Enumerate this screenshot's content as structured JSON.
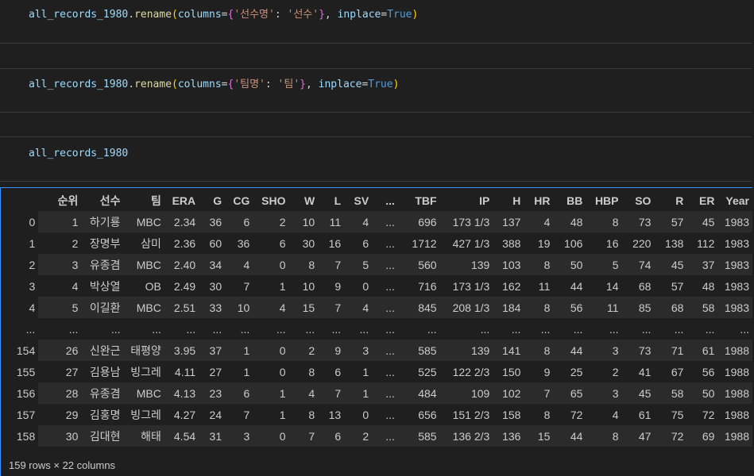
{
  "cells": [
    {
      "tokens": [
        {
          "t": "all_records_1980",
          "c": "var"
        },
        {
          "t": ".",
          "c": "pun"
        },
        {
          "t": "rename",
          "c": "fn"
        },
        {
          "t": "(",
          "c": "par"
        },
        {
          "t": "columns",
          "c": "var"
        },
        {
          "t": "=",
          "c": "op"
        },
        {
          "t": "{",
          "c": "br"
        },
        {
          "t": "'선수명'",
          "c": "str"
        },
        {
          "t": ": ",
          "c": "pun"
        },
        {
          "t": "'선수'",
          "c": "str"
        },
        {
          "t": "}",
          "c": "br"
        },
        {
          "t": ", ",
          "c": "pun"
        },
        {
          "t": "inplace",
          "c": "var"
        },
        {
          "t": "=",
          "c": "op"
        },
        {
          "t": "True",
          "c": "kw"
        },
        {
          "t": ")",
          "c": "par"
        }
      ]
    },
    {
      "tokens": [
        {
          "t": "all_records_1980",
          "c": "var"
        },
        {
          "t": ".",
          "c": "pun"
        },
        {
          "t": "rename",
          "c": "fn"
        },
        {
          "t": "(",
          "c": "par"
        },
        {
          "t": "columns",
          "c": "var"
        },
        {
          "t": "=",
          "c": "op"
        },
        {
          "t": "{",
          "c": "br"
        },
        {
          "t": "'팀명'",
          "c": "str"
        },
        {
          "t": ": ",
          "c": "pun"
        },
        {
          "t": "'팀'",
          "c": "str"
        },
        {
          "t": "}",
          "c": "br"
        },
        {
          "t": ", ",
          "c": "pun"
        },
        {
          "t": "inplace",
          "c": "var"
        },
        {
          "t": "=",
          "c": "op"
        },
        {
          "t": "True",
          "c": "kw"
        },
        {
          "t": ")",
          "c": "par"
        }
      ]
    },
    {
      "tokens": [
        {
          "t": "all_records_1980",
          "c": "var"
        }
      ]
    }
  ],
  "table": {
    "columns": [
      "",
      "순위",
      "선수",
      "팀",
      "ERA",
      "G",
      "CG",
      "SHO",
      "W",
      "L",
      "SV",
      "...",
      "TBF",
      "IP",
      "H",
      "HR",
      "BB",
      "HBP",
      "SO",
      "R",
      "ER",
      "Year"
    ],
    "rows": [
      [
        "0",
        "1",
        "하기룡",
        "MBC",
        "2.34",
        "36",
        "6",
        "2",
        "10",
        "11",
        "4",
        "...",
        "696",
        "173 1/3",
        "137",
        "4",
        "48",
        "8",
        "73",
        "57",
        "45",
        "1983"
      ],
      [
        "1",
        "2",
        "장명부",
        "삼미",
        "2.36",
        "60",
        "36",
        "6",
        "30",
        "16",
        "6",
        "...",
        "1712",
        "427 1/3",
        "388",
        "19",
        "106",
        "16",
        "220",
        "138",
        "112",
        "1983"
      ],
      [
        "2",
        "3",
        "유종겸",
        "MBC",
        "2.40",
        "34",
        "4",
        "0",
        "8",
        "7",
        "5",
        "...",
        "560",
        "139",
        "103",
        "8",
        "50",
        "5",
        "74",
        "45",
        "37",
        "1983"
      ],
      [
        "3",
        "4",
        "박상열",
        "OB",
        "2.49",
        "30",
        "7",
        "1",
        "10",
        "9",
        "0",
        "...",
        "716",
        "173 1/3",
        "162",
        "11",
        "44",
        "14",
        "68",
        "57",
        "48",
        "1983"
      ],
      [
        "4",
        "5",
        "이길환",
        "MBC",
        "2.51",
        "33",
        "10",
        "4",
        "15",
        "7",
        "4",
        "...",
        "845",
        "208 1/3",
        "184",
        "8",
        "56",
        "11",
        "85",
        "68",
        "58",
        "1983"
      ],
      [
        "...",
        "...",
        "...",
        "...",
        "...",
        "...",
        "...",
        "...",
        "...",
        "...",
        "...",
        "...",
        "...",
        "...",
        "...",
        "...",
        "...",
        "...",
        "...",
        "...",
        "...",
        "..."
      ],
      [
        "154",
        "26",
        "신완근",
        "태평양",
        "3.95",
        "37",
        "1",
        "0",
        "2",
        "9",
        "3",
        "...",
        "585",
        "139",
        "141",
        "8",
        "44",
        "3",
        "73",
        "71",
        "61",
        "1988"
      ],
      [
        "155",
        "27",
        "김용남",
        "빙그레",
        "4.11",
        "27",
        "1",
        "0",
        "8",
        "6",
        "1",
        "...",
        "525",
        "122 2/3",
        "150",
        "9",
        "25",
        "2",
        "41",
        "67",
        "56",
        "1988"
      ],
      [
        "156",
        "28",
        "유종겸",
        "MBC",
        "4.13",
        "23",
        "6",
        "1",
        "4",
        "7",
        "1",
        "...",
        "484",
        "109",
        "102",
        "7",
        "65",
        "3",
        "45",
        "58",
        "50",
        "1988"
      ],
      [
        "157",
        "29",
        "김홍명",
        "빙그레",
        "4.27",
        "24",
        "7",
        "1",
        "8",
        "13",
        "0",
        "...",
        "656",
        "151 2/3",
        "158",
        "8",
        "72",
        "4",
        "61",
        "75",
        "72",
        "1988"
      ],
      [
        "158",
        "30",
        "김대현",
        "해태",
        "4.54",
        "31",
        "3",
        "0",
        "7",
        "6",
        "2",
        "...",
        "585",
        "136 2/3",
        "136",
        "15",
        "44",
        "8",
        "47",
        "72",
        "69",
        "1988"
      ]
    ],
    "footer": "159 rows × 22 columns"
  }
}
